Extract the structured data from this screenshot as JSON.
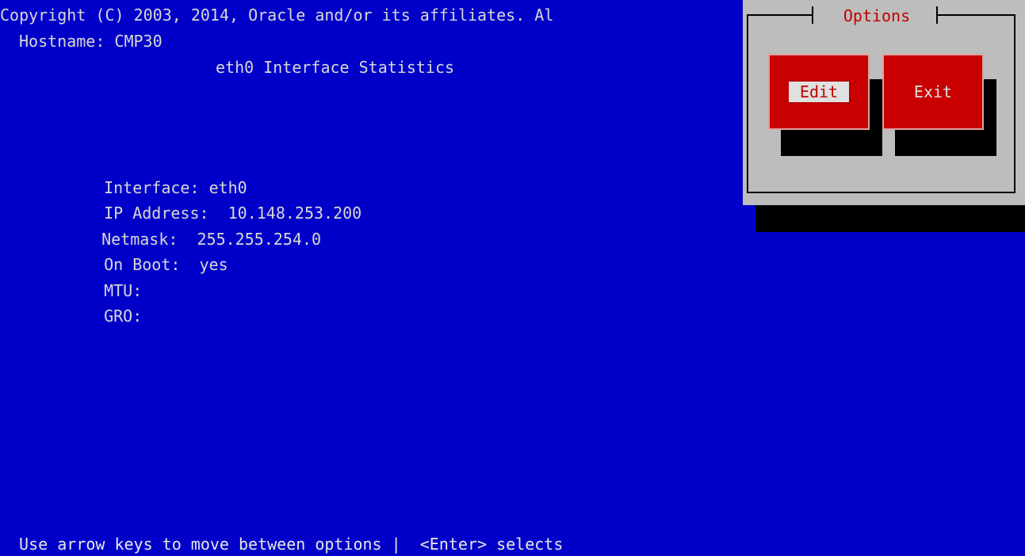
{
  "header": {
    "copyright": "Copyright (C) 2003, 2014, Oracle and/or its affiliates. Al",
    "hostname": "Hostname: CMP30",
    "title": "eth0 Interface Statistics"
  },
  "fields": [
    {
      "label": "Interface:",
      "value": "eth0"
    },
    {
      "label": "IP Address:",
      "value": "10.148.253.200"
    },
    {
      "label": "Netmask:",
      "value": "255.255.254.0"
    },
    {
      "label": "On Boot:",
      "value": "yes"
    },
    {
      "label": "MTU:",
      "value": ""
    },
    {
      "label": "GRO:",
      "value": ""
    }
  ],
  "dialog": {
    "title": "Options",
    "edit_label": "Edit",
    "exit_label": "Exit",
    "selected": "Edit"
  },
  "footer": {
    "help": " Use arrow keys to move between options |  <Enter> selects"
  },
  "colors": {
    "background": "#0000c8",
    "dialog": "#bdbdbd",
    "button": "#c80000",
    "title": "#c00000"
  }
}
